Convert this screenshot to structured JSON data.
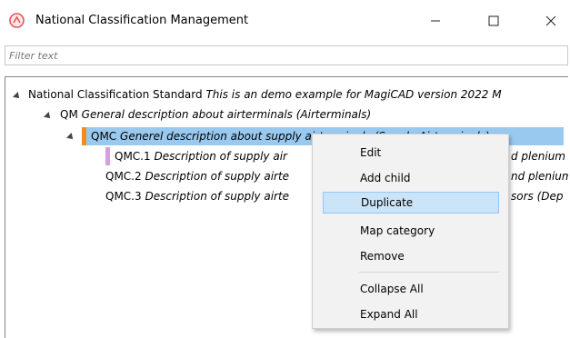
{
  "window": {
    "title": "National Classification Management",
    "buttons": {
      "minimize": "—",
      "maximize": "☐",
      "close": "✕"
    }
  },
  "filter": {
    "placeholder": "Filter text",
    "value": ""
  },
  "tree": [
    {
      "code": "National Classification Standard",
      "desc": "This is an demo example for MagiCAD version 2022 M",
      "expanded": true
    },
    {
      "code": "QM",
      "desc": "General description about airterminals (Airterminals)",
      "expanded": true
    },
    {
      "code": "QMC",
      "desc": "Generel description about supply airterminals (Supply Airterminals)",
      "expanded": true,
      "selected": true,
      "marker_color": "#f28c1e"
    },
    {
      "code": "QMC.1",
      "desc": "Description of supply air",
      "desc_right": "d plenium",
      "marker_color": "#d59fe0"
    },
    {
      "code": "QMC.2",
      "desc": "Description of supply airte",
      "desc_right": "nd plenium"
    },
    {
      "code": "QMC.3",
      "desc": "Description of supply airte",
      "desc_right": "sors  (Dep"
    }
  ],
  "context_menu": {
    "items": [
      "Edit",
      "Add child",
      "Duplicate",
      "Map category",
      "Remove",
      "Collapse All",
      "Expand All"
    ],
    "highlighted": "Duplicate"
  },
  "colors": {
    "selection": "#99c9ef",
    "menu_highlight": "#cce4f7",
    "app_icon": "#e0565b"
  },
  "icons": [
    "app-icon",
    "minimize-icon",
    "maximize-icon",
    "close-icon",
    "expand-arrow-icon"
  ]
}
